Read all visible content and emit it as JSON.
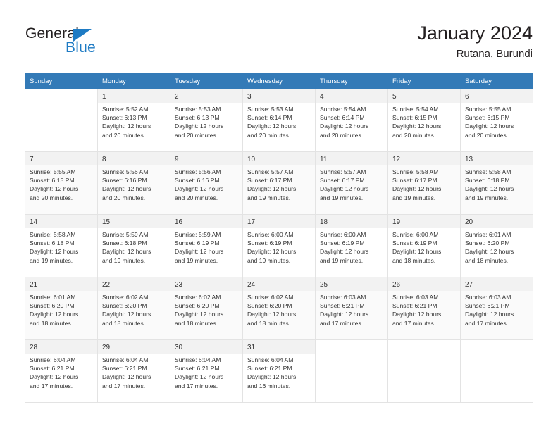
{
  "brand": {
    "name_part1": "General",
    "name_part2": "Blue",
    "triangle_icon": "blue-triangle-icon",
    "accent_color": "#1e7bc4"
  },
  "header": {
    "title": "January 2024",
    "subtitle": "Rutana, Burundi"
  },
  "calendar": {
    "header_bg": "#337ab7",
    "weekdays": [
      "Sunday",
      "Monday",
      "Tuesday",
      "Wednesday",
      "Thursday",
      "Friday",
      "Saturday"
    ],
    "weeks": [
      {
        "shaded": false,
        "days": [
          {
            "num": "",
            "sunrise": "",
            "sunset": "",
            "daylight1": "",
            "daylight2": ""
          },
          {
            "num": "1",
            "sunrise": "Sunrise: 5:52 AM",
            "sunset": "Sunset: 6:13 PM",
            "daylight1": "Daylight: 12 hours",
            "daylight2": "and 20 minutes."
          },
          {
            "num": "2",
            "sunrise": "Sunrise: 5:53 AM",
            "sunset": "Sunset: 6:13 PM",
            "daylight1": "Daylight: 12 hours",
            "daylight2": "and 20 minutes."
          },
          {
            "num": "3",
            "sunrise": "Sunrise: 5:53 AM",
            "sunset": "Sunset: 6:14 PM",
            "daylight1": "Daylight: 12 hours",
            "daylight2": "and 20 minutes."
          },
          {
            "num": "4",
            "sunrise": "Sunrise: 5:54 AM",
            "sunset": "Sunset: 6:14 PM",
            "daylight1": "Daylight: 12 hours",
            "daylight2": "and 20 minutes."
          },
          {
            "num": "5",
            "sunrise": "Sunrise: 5:54 AM",
            "sunset": "Sunset: 6:15 PM",
            "daylight1": "Daylight: 12 hours",
            "daylight2": "and 20 minutes."
          },
          {
            "num": "6",
            "sunrise": "Sunrise: 5:55 AM",
            "sunset": "Sunset: 6:15 PM",
            "daylight1": "Daylight: 12 hours",
            "daylight2": "and 20 minutes."
          }
        ]
      },
      {
        "shaded": true,
        "days": [
          {
            "num": "7",
            "sunrise": "Sunrise: 5:55 AM",
            "sunset": "Sunset: 6:15 PM",
            "daylight1": "Daylight: 12 hours",
            "daylight2": "and 20 minutes."
          },
          {
            "num": "8",
            "sunrise": "Sunrise: 5:56 AM",
            "sunset": "Sunset: 6:16 PM",
            "daylight1": "Daylight: 12 hours",
            "daylight2": "and 20 minutes."
          },
          {
            "num": "9",
            "sunrise": "Sunrise: 5:56 AM",
            "sunset": "Sunset: 6:16 PM",
            "daylight1": "Daylight: 12 hours",
            "daylight2": "and 20 minutes."
          },
          {
            "num": "10",
            "sunrise": "Sunrise: 5:57 AM",
            "sunset": "Sunset: 6:17 PM",
            "daylight1": "Daylight: 12 hours",
            "daylight2": "and 19 minutes."
          },
          {
            "num": "11",
            "sunrise": "Sunrise: 5:57 AM",
            "sunset": "Sunset: 6:17 PM",
            "daylight1": "Daylight: 12 hours",
            "daylight2": "and 19 minutes."
          },
          {
            "num": "12",
            "sunrise": "Sunrise: 5:58 AM",
            "sunset": "Sunset: 6:17 PM",
            "daylight1": "Daylight: 12 hours",
            "daylight2": "and 19 minutes."
          },
          {
            "num": "13",
            "sunrise": "Sunrise: 5:58 AM",
            "sunset": "Sunset: 6:18 PM",
            "daylight1": "Daylight: 12 hours",
            "daylight2": "and 19 minutes."
          }
        ]
      },
      {
        "shaded": false,
        "days": [
          {
            "num": "14",
            "sunrise": "Sunrise: 5:58 AM",
            "sunset": "Sunset: 6:18 PM",
            "daylight1": "Daylight: 12 hours",
            "daylight2": "and 19 minutes."
          },
          {
            "num": "15",
            "sunrise": "Sunrise: 5:59 AM",
            "sunset": "Sunset: 6:18 PM",
            "daylight1": "Daylight: 12 hours",
            "daylight2": "and 19 minutes."
          },
          {
            "num": "16",
            "sunrise": "Sunrise: 5:59 AM",
            "sunset": "Sunset: 6:19 PM",
            "daylight1": "Daylight: 12 hours",
            "daylight2": "and 19 minutes."
          },
          {
            "num": "17",
            "sunrise": "Sunrise: 6:00 AM",
            "sunset": "Sunset: 6:19 PM",
            "daylight1": "Daylight: 12 hours",
            "daylight2": "and 19 minutes."
          },
          {
            "num": "18",
            "sunrise": "Sunrise: 6:00 AM",
            "sunset": "Sunset: 6:19 PM",
            "daylight1": "Daylight: 12 hours",
            "daylight2": "and 19 minutes."
          },
          {
            "num": "19",
            "sunrise": "Sunrise: 6:00 AM",
            "sunset": "Sunset: 6:19 PM",
            "daylight1": "Daylight: 12 hours",
            "daylight2": "and 18 minutes."
          },
          {
            "num": "20",
            "sunrise": "Sunrise: 6:01 AM",
            "sunset": "Sunset: 6:20 PM",
            "daylight1": "Daylight: 12 hours",
            "daylight2": "and 18 minutes."
          }
        ]
      },
      {
        "shaded": true,
        "days": [
          {
            "num": "21",
            "sunrise": "Sunrise: 6:01 AM",
            "sunset": "Sunset: 6:20 PM",
            "daylight1": "Daylight: 12 hours",
            "daylight2": "and 18 minutes."
          },
          {
            "num": "22",
            "sunrise": "Sunrise: 6:02 AM",
            "sunset": "Sunset: 6:20 PM",
            "daylight1": "Daylight: 12 hours",
            "daylight2": "and 18 minutes."
          },
          {
            "num": "23",
            "sunrise": "Sunrise: 6:02 AM",
            "sunset": "Sunset: 6:20 PM",
            "daylight1": "Daylight: 12 hours",
            "daylight2": "and 18 minutes."
          },
          {
            "num": "24",
            "sunrise": "Sunrise: 6:02 AM",
            "sunset": "Sunset: 6:20 PM",
            "daylight1": "Daylight: 12 hours",
            "daylight2": "and 18 minutes."
          },
          {
            "num": "25",
            "sunrise": "Sunrise: 6:03 AM",
            "sunset": "Sunset: 6:21 PM",
            "daylight1": "Daylight: 12 hours",
            "daylight2": "and 17 minutes."
          },
          {
            "num": "26",
            "sunrise": "Sunrise: 6:03 AM",
            "sunset": "Sunset: 6:21 PM",
            "daylight1": "Daylight: 12 hours",
            "daylight2": "and 17 minutes."
          },
          {
            "num": "27",
            "sunrise": "Sunrise: 6:03 AM",
            "sunset": "Sunset: 6:21 PM",
            "daylight1": "Daylight: 12 hours",
            "daylight2": "and 17 minutes."
          }
        ]
      },
      {
        "shaded": false,
        "days": [
          {
            "num": "28",
            "sunrise": "Sunrise: 6:04 AM",
            "sunset": "Sunset: 6:21 PM",
            "daylight1": "Daylight: 12 hours",
            "daylight2": "and 17 minutes."
          },
          {
            "num": "29",
            "sunrise": "Sunrise: 6:04 AM",
            "sunset": "Sunset: 6:21 PM",
            "daylight1": "Daylight: 12 hours",
            "daylight2": "and 17 minutes."
          },
          {
            "num": "30",
            "sunrise": "Sunrise: 6:04 AM",
            "sunset": "Sunset: 6:21 PM",
            "daylight1": "Daylight: 12 hours",
            "daylight2": "and 17 minutes."
          },
          {
            "num": "31",
            "sunrise": "Sunrise: 6:04 AM",
            "sunset": "Sunset: 6:21 PM",
            "daylight1": "Daylight: 12 hours",
            "daylight2": "and 16 minutes."
          },
          {
            "num": "",
            "sunrise": "",
            "sunset": "",
            "daylight1": "",
            "daylight2": ""
          },
          {
            "num": "",
            "sunrise": "",
            "sunset": "",
            "daylight1": "",
            "daylight2": ""
          },
          {
            "num": "",
            "sunrise": "",
            "sunset": "",
            "daylight1": "",
            "daylight2": ""
          }
        ]
      }
    ]
  }
}
